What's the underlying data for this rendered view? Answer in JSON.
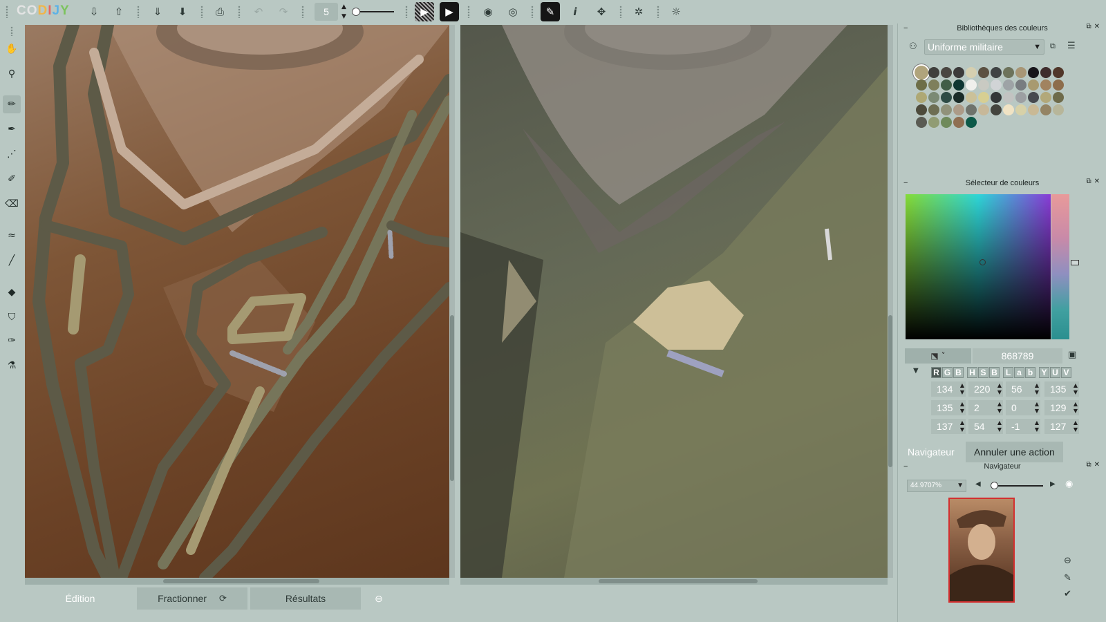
{
  "app": {
    "logo_text": "CODIJY",
    "brush_size": "5"
  },
  "toolbar": {
    "buttons": [
      {
        "name": "import-icon",
        "glyph": "⇩"
      },
      {
        "name": "export-icon",
        "glyph": "⇧"
      },
      {
        "name": "download-icon",
        "glyph": "⇓"
      },
      {
        "name": "save-icon",
        "glyph": "⬇"
      },
      {
        "name": "print-icon",
        "glyph": "⎙"
      },
      {
        "name": "undo-icon",
        "glyph": "↶"
      },
      {
        "name": "redo-icon",
        "glyph": "↷"
      },
      {
        "name": "preview-icon",
        "glyph": "▶"
      },
      {
        "name": "play-icon",
        "glyph": "▶"
      },
      {
        "name": "eye-icon",
        "glyph": "◉"
      },
      {
        "name": "mask-eye-icon",
        "glyph": "◎"
      },
      {
        "name": "pen-mode-icon",
        "glyph": "✎"
      },
      {
        "name": "info-icon",
        "glyph": "i"
      },
      {
        "name": "fullscreen-icon",
        "glyph": "✥"
      },
      {
        "name": "settings-icon",
        "glyph": "✲"
      },
      {
        "name": "bug-icon",
        "glyph": "☼"
      }
    ]
  },
  "tools": [
    {
      "name": "hand-tool-icon",
      "glyph": "✋"
    },
    {
      "name": "zoom-tool-icon",
      "glyph": "⚲"
    },
    {
      "name": "pencil-tool-icon",
      "glyph": "✏"
    },
    {
      "name": "marker-tool-icon",
      "glyph": "✒"
    },
    {
      "name": "dotted-brush-icon",
      "glyph": "⋰"
    },
    {
      "name": "brush-tool-icon",
      "glyph": "✐"
    },
    {
      "name": "eraser-tool-icon",
      "glyph": "⌫"
    },
    {
      "name": "gradient-tool-icon",
      "glyph": "≈"
    },
    {
      "name": "line-tool-icon",
      "glyph": "╱"
    },
    {
      "name": "fill-tool-icon",
      "glyph": "◆"
    },
    {
      "name": "stamp-tool-icon",
      "glyph": "⛉"
    },
    {
      "name": "color-brush-icon",
      "glyph": "✑"
    },
    {
      "name": "eyedropper-icon",
      "glyph": "⚗"
    }
  ],
  "bottom_tabs": {
    "edition": "Édition",
    "split": "Fractionner",
    "results": "Résultats"
  },
  "colors": {
    "accent_canvas_border": "#d32f2f",
    "stroke_olive": "#76755a",
    "stroke_dark": "#5d5a47",
    "stroke_light": "#c4ac98",
    "stroke_khaki": "#a59a72",
    "stroke_grey": "#9ea1ad"
  },
  "library_panel": {
    "title": "Bibliothèques des couleurs",
    "selected_library": "Uniforme militaire",
    "swatches": [
      "#b0a47c",
      "#3f3f3c",
      "#4a4641",
      "#3c3a3a",
      "#d5cfb0",
      "#5b5142",
      "#3f4343",
      "#6d735b",
      "#a89676",
      "#17151a",
      "#3f2d2d",
      "#503629",
      "#6d6e47",
      "#7e7f5c",
      "#415d47",
      "#0f3632",
      "#f0f0ec",
      "#c9cac2",
      "#d1d4d6",
      "#9ea3a6",
      "#787c80",
      "#a89a70",
      "#a18360",
      "#8d6d4b",
      "#aea874",
      "#7b8a74",
      "#2e4b45",
      "#1a2b28",
      "#cbc199",
      "#d7cf93",
      "#333737",
      "#c2c3c1",
      "#9c9fa2",
      "#46494e",
      "#b2a87a",
      "#6e6b4a",
      "#4d4b3c",
      "#6d6e53",
      "#90927a",
      "#ac9b88",
      "#6f736c",
      "#c7b899",
      "#44453e",
      "#f0e3c4",
      "#d7d1a8",
      "#c9b995",
      "#948464",
      "#b7b69a",
      "#5a5b53",
      "#919c74",
      "#6f8a5b",
      "#8f6f52",
      "#0c5948"
    ]
  },
  "picker_panel": {
    "title": "Sélecteur de couleurs",
    "format_icon": "⬔",
    "hex": "868789",
    "modes": [
      "R",
      "G",
      "B",
      "H",
      "S",
      "B",
      "L",
      "a",
      "b",
      "Y",
      "U",
      "V"
    ],
    "values": [
      [
        "134",
        "220",
        "56",
        "135"
      ],
      [
        "135",
        "2",
        "0",
        "129"
      ],
      [
        "137",
        "54",
        "-1",
        "127"
      ]
    ]
  },
  "navigator_panel": {
    "tab_navigator": "Navigateur",
    "tab_undo": "Annuler une action",
    "title": "Navigateur",
    "zoom": "44.9707%"
  }
}
